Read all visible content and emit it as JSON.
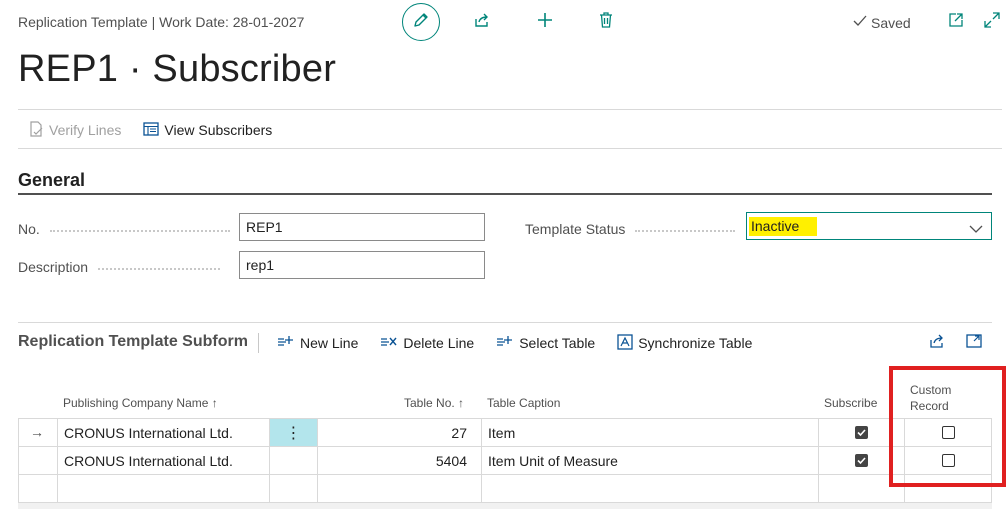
{
  "header": {
    "caption": "Replication Template | Work Date: 28-01-2027",
    "saved_label": "Saved",
    "icons": [
      "edit-icon",
      "share-icon",
      "add-icon",
      "delete-icon",
      "check-icon",
      "open-new-window-icon",
      "expand-icon"
    ]
  },
  "page": {
    "title": "REP1 · Subscriber"
  },
  "actions": {
    "verify_lines": "Verify Lines",
    "view_subscribers": "View Subscribers"
  },
  "general": {
    "title": "General",
    "no_label": "No.",
    "no_value": "REP1",
    "description_label": "Description",
    "description_value": "rep1",
    "status_label": "Template Status",
    "status_value": "Inactive"
  },
  "subform": {
    "title": "Replication Template Subform",
    "new_line": "New Line",
    "delete_line": "Delete Line",
    "select_table": "Select Table",
    "synchronize_table": "Synchronize Table",
    "columns": {
      "publishing_company": "Publishing Company Name",
      "table_no": "Table No.",
      "table_caption": "Table Caption",
      "subscribe": "Subscribe",
      "custom_record_1": "Custom",
      "custom_record_2": "Record"
    },
    "rows": [
      {
        "company": "CRONUS International Ltd.",
        "table_no": "27",
        "caption": "Item",
        "subscribe": true,
        "custom_record": false
      },
      {
        "company": "CRONUS International Ltd.",
        "table_no": "5404",
        "caption": "Item Unit of Measure",
        "subscribe": true,
        "custom_record": false
      }
    ]
  },
  "colors": {
    "accent": "#00857a",
    "highlight_yellow": "#fff000",
    "annotation_red": "#e02020",
    "selected_cell": "#b3e5ec"
  }
}
